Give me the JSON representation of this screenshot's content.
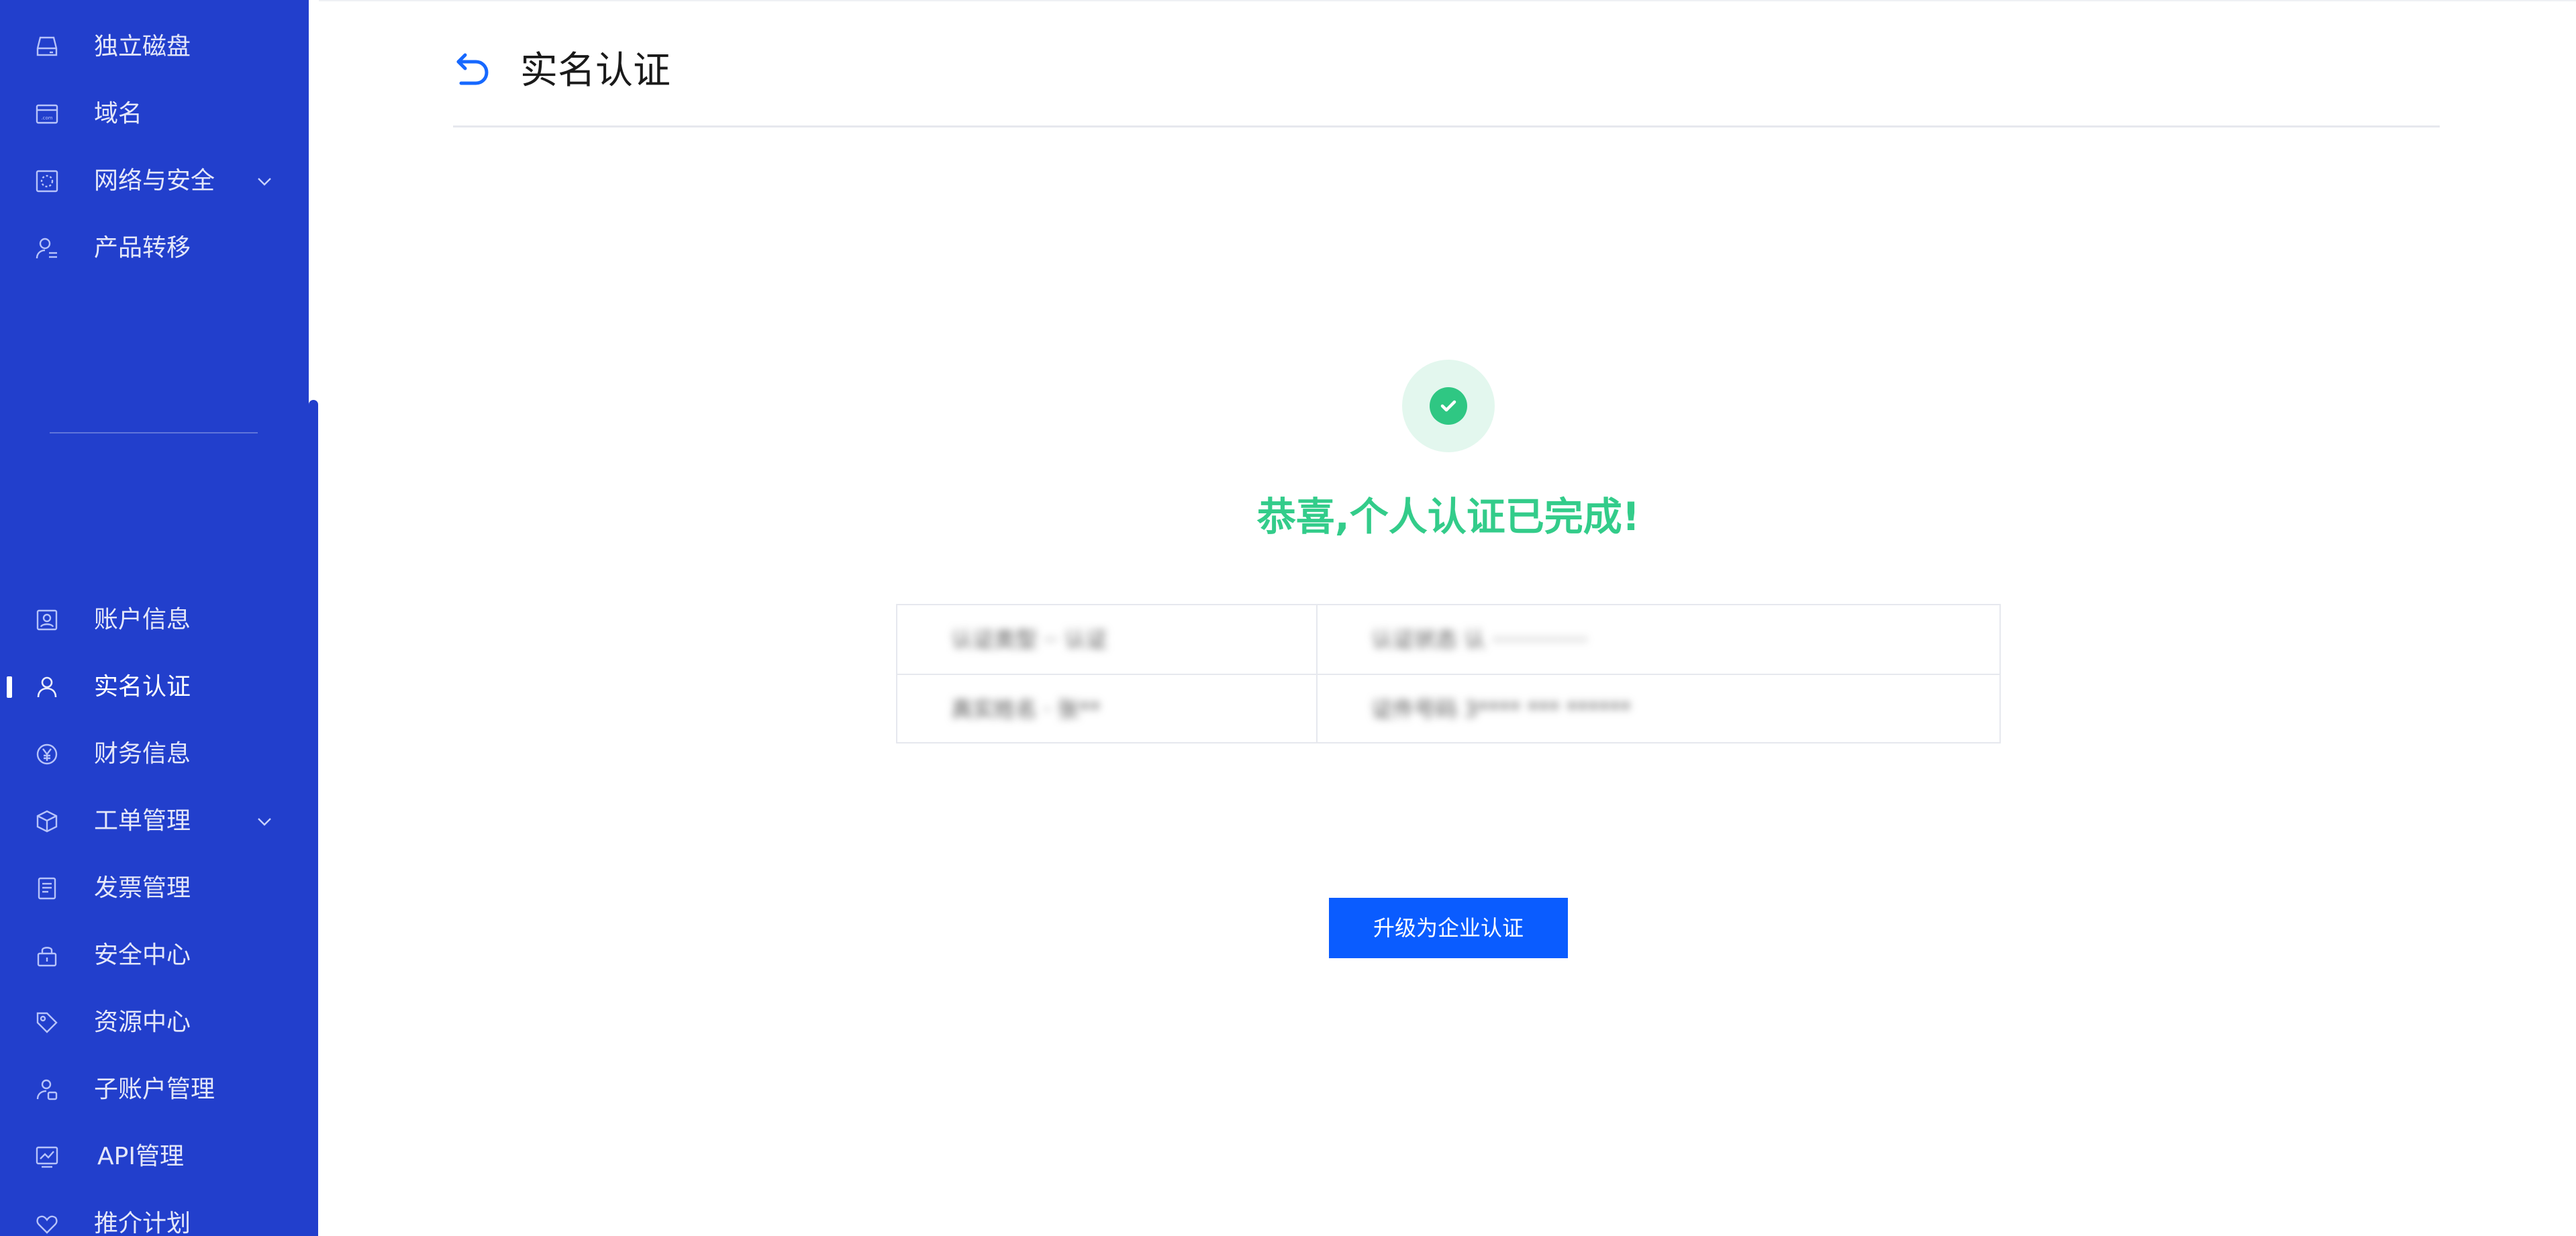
{
  "sidebar": {
    "items": [
      {
        "label": "独立磁盘",
        "icon": "disk-icon"
      },
      {
        "label": "域名",
        "icon": "domain-icon"
      },
      {
        "label": "网络与安全",
        "icon": "network-security-icon",
        "expandable": true
      },
      {
        "label": "产品转移",
        "icon": "product-transfer-icon"
      },
      {
        "label": "账户信息",
        "icon": "account-info-icon"
      },
      {
        "label": "实名认证",
        "icon": "user-icon",
        "active": true
      },
      {
        "label": "财务信息",
        "icon": "yen-icon"
      },
      {
        "label": "工单管理",
        "icon": "cube-icon",
        "expandable": true
      },
      {
        "label": "发票管理",
        "icon": "invoice-icon"
      },
      {
        "label": "安全中心",
        "icon": "lock-icon"
      },
      {
        "label": "资源中心",
        "icon": "tag-icon"
      },
      {
        "label": "子账户管理",
        "icon": "sub-account-icon"
      },
      {
        "label": "API管理",
        "icon": "api-chart-icon"
      },
      {
        "label": "推介计划",
        "icon": "heart-icon"
      }
    ]
  },
  "header": {
    "title": "实名认证"
  },
  "result": {
    "message": "恭喜,个人认证已完成!"
  },
  "info_rows": [
    {
      "label": "认证类型 ·· 认证",
      "value": "认证状态 认 ··············"
    },
    {
      "label": "真实姓名 · 张**",
      "value": "证件号码 3**** *** ******"
    }
  ],
  "actions": {
    "upgrade_label": "升级为企业认证"
  },
  "colors": {
    "sidebar_bg": "#223fcc",
    "primary": "#0a5cff",
    "success": "#33cc8a"
  }
}
